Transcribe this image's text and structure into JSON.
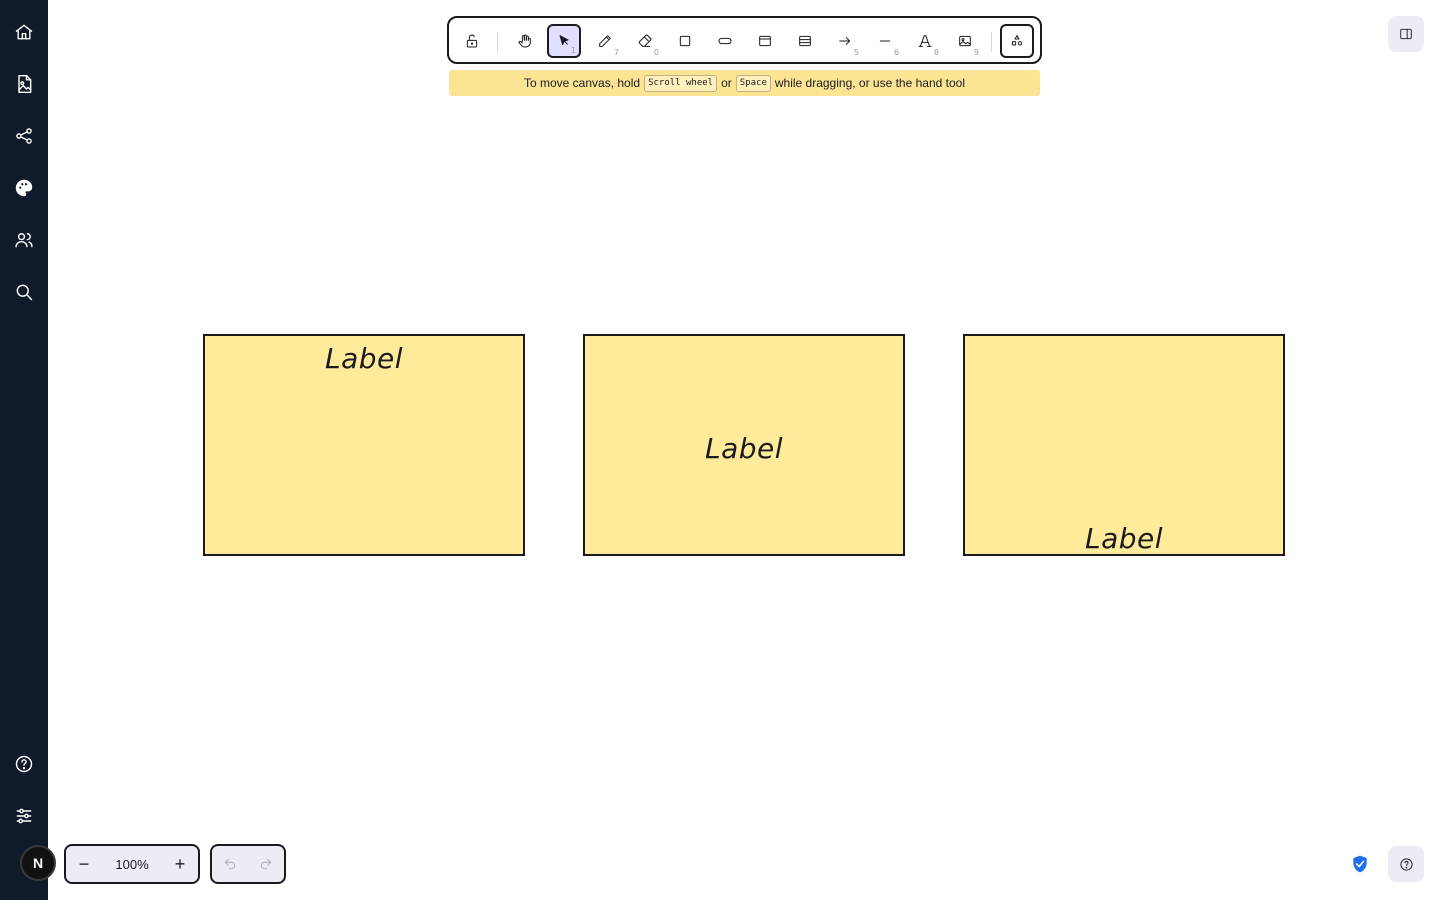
{
  "sidebar": {
    "items": [
      {
        "icon": "home-icon"
      },
      {
        "icon": "image-file-icon"
      },
      {
        "icon": "share-icon"
      },
      {
        "icon": "palette-icon"
      },
      {
        "icon": "users-icon"
      },
      {
        "icon": "search-icon"
      }
    ],
    "bottom_items": [
      {
        "icon": "help-icon"
      },
      {
        "icon": "settings-sliders-icon"
      }
    ]
  },
  "toolbar": {
    "tools": [
      {
        "name": "lock",
        "icon": "lock-icon",
        "key": ""
      },
      {
        "name": "hand",
        "icon": "hand-icon",
        "key": ""
      },
      {
        "name": "selection",
        "icon": "pointer-icon",
        "key": "1",
        "active": true
      },
      {
        "name": "draw",
        "icon": "pencil-icon",
        "key": "7"
      },
      {
        "name": "eraser",
        "icon": "eraser-icon",
        "key": "0"
      },
      {
        "name": "rectangle",
        "icon": "square-icon",
        "key": ""
      },
      {
        "name": "ellipse",
        "icon": "pill-icon",
        "key": ""
      },
      {
        "name": "frame",
        "icon": "frame-icon",
        "key": ""
      },
      {
        "name": "table",
        "icon": "table-icon",
        "key": ""
      },
      {
        "name": "arrow",
        "icon": "arrow-icon",
        "key": "5"
      },
      {
        "name": "line",
        "icon": "line-icon",
        "key": "6"
      },
      {
        "name": "text",
        "icon": "text-icon",
        "key": "8"
      },
      {
        "name": "image",
        "icon": "image-icon",
        "key": "9"
      },
      {
        "name": "library",
        "icon": "shapes-library-icon",
        "key": ""
      }
    ]
  },
  "hint": {
    "prefix": "To move canvas, hold",
    "key1": "Scroll wheel",
    "middle": "or",
    "key2": "Space",
    "suffix": "while dragging, or use the hand tool"
  },
  "canvas": {
    "notes": [
      {
        "label": "Label",
        "align": "top"
      },
      {
        "label": "Label",
        "align": "middle"
      },
      {
        "label": "Label",
        "align": "bottom"
      }
    ],
    "fill_color": "#ffeb99",
    "stroke_color": "#1b1b1f"
  },
  "zoom": {
    "minus": "−",
    "value": "100%",
    "plus": "+"
  },
  "user": {
    "initial": "N"
  },
  "colors": {
    "sidebar_bg": "#0f1b2a",
    "hint_bg": "#fbe595",
    "active_tool_bg": "#e0dfff",
    "shield_color": "#1e6ef0"
  }
}
